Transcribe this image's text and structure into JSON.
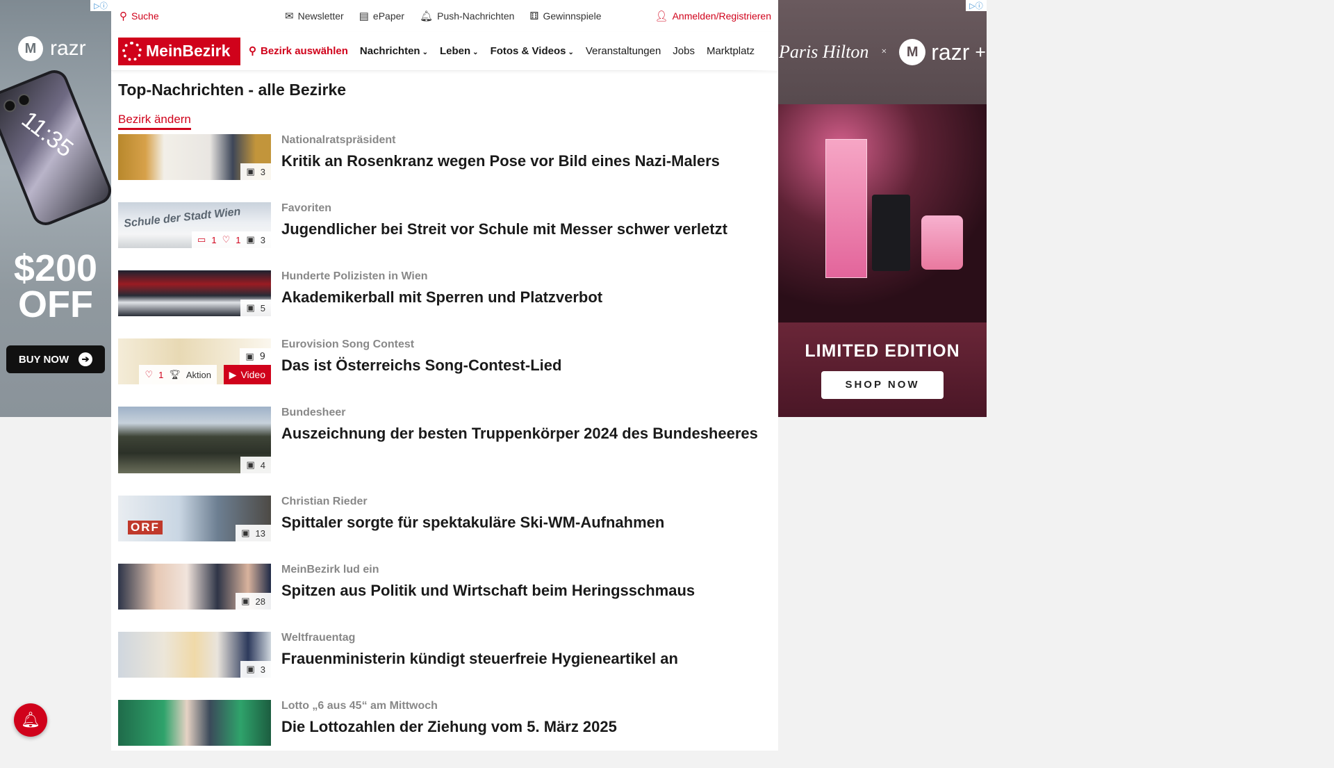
{
  "ad_left": {
    "brand": "razr",
    "phone_time": "11:35",
    "promo_amount": "$200",
    "promo_off": "OFF",
    "cta": "BUY NOW"
  },
  "utility_bar": {
    "search": "Suche",
    "newsletter": "Newsletter",
    "epaper": "ePaper",
    "push": "Push-Nachrichten",
    "contests": "Gewinnspiele",
    "login": "Anmelden/Registrieren"
  },
  "nav": {
    "logo": "MeinBezirk",
    "region": "Bezirk auswählen",
    "items": [
      "Nachrichten",
      "Leben",
      "Fotos & Videos",
      "Veranstaltungen",
      "Jobs",
      "Marktplatz"
    ]
  },
  "page": {
    "title": "Top-Nachrichten - alle Bezirke",
    "change_district": "Bezirk ändern"
  },
  "articles": [
    {
      "kicker": "Nationalratspräsident",
      "headline": "Kritik an Rosenkranz wegen Pose vor Bild eines Nazi-Malers",
      "photos": "3"
    },
    {
      "kicker": "Favoriten",
      "headline": "Jugendlicher bei Streit vor Schule mit Messer schwer verletzt",
      "comments": "1",
      "likes": "1",
      "photos": "3",
      "thumb_text": "Schule der Stadt Wien"
    },
    {
      "kicker": "Hunderte Polizisten in Wien",
      "headline": "Akademikerball mit Sperren und Platzverbot",
      "photos": "5"
    },
    {
      "kicker": "Eurovision Song Contest",
      "headline": "Das ist Österreichs Song-Contest-Lied",
      "photos": "9",
      "likes": "1",
      "action": "Aktion",
      "video": "Video"
    },
    {
      "kicker": "Bundesheer",
      "headline": "Auszeichnung der besten Truppenkörper 2024 des Bundesheeres",
      "photos": "4"
    },
    {
      "kicker": "Christian Rieder",
      "headline": "Spittaler sorgte für spektakuläre Ski-WM-Aufnahmen",
      "photos": "13",
      "thumb_text": "ORF"
    },
    {
      "kicker": "MeinBezirk lud ein",
      "headline": "Spitzen aus Politik und Wirtschaft beim Heringsschmaus",
      "photos": "28"
    },
    {
      "kicker": "Weltfrauentag",
      "headline": "Frauenministerin kündigt steuerfreie Hygieneartikel an",
      "photos": "3"
    },
    {
      "kicker": "Lotto „6 aus 45“ am Mittwoch",
      "headline": "Die Lottozahlen der Ziehung vom 5. März 2025"
    }
  ],
  "ad_right": {
    "signature": "Paris Hilton",
    "x": "×",
    "brand": "razr",
    "brand_plus": "+",
    "headline": "LIMITED EDITION",
    "cta": "SHOP NOW"
  },
  "colors": {
    "accent": "#d0021b"
  }
}
